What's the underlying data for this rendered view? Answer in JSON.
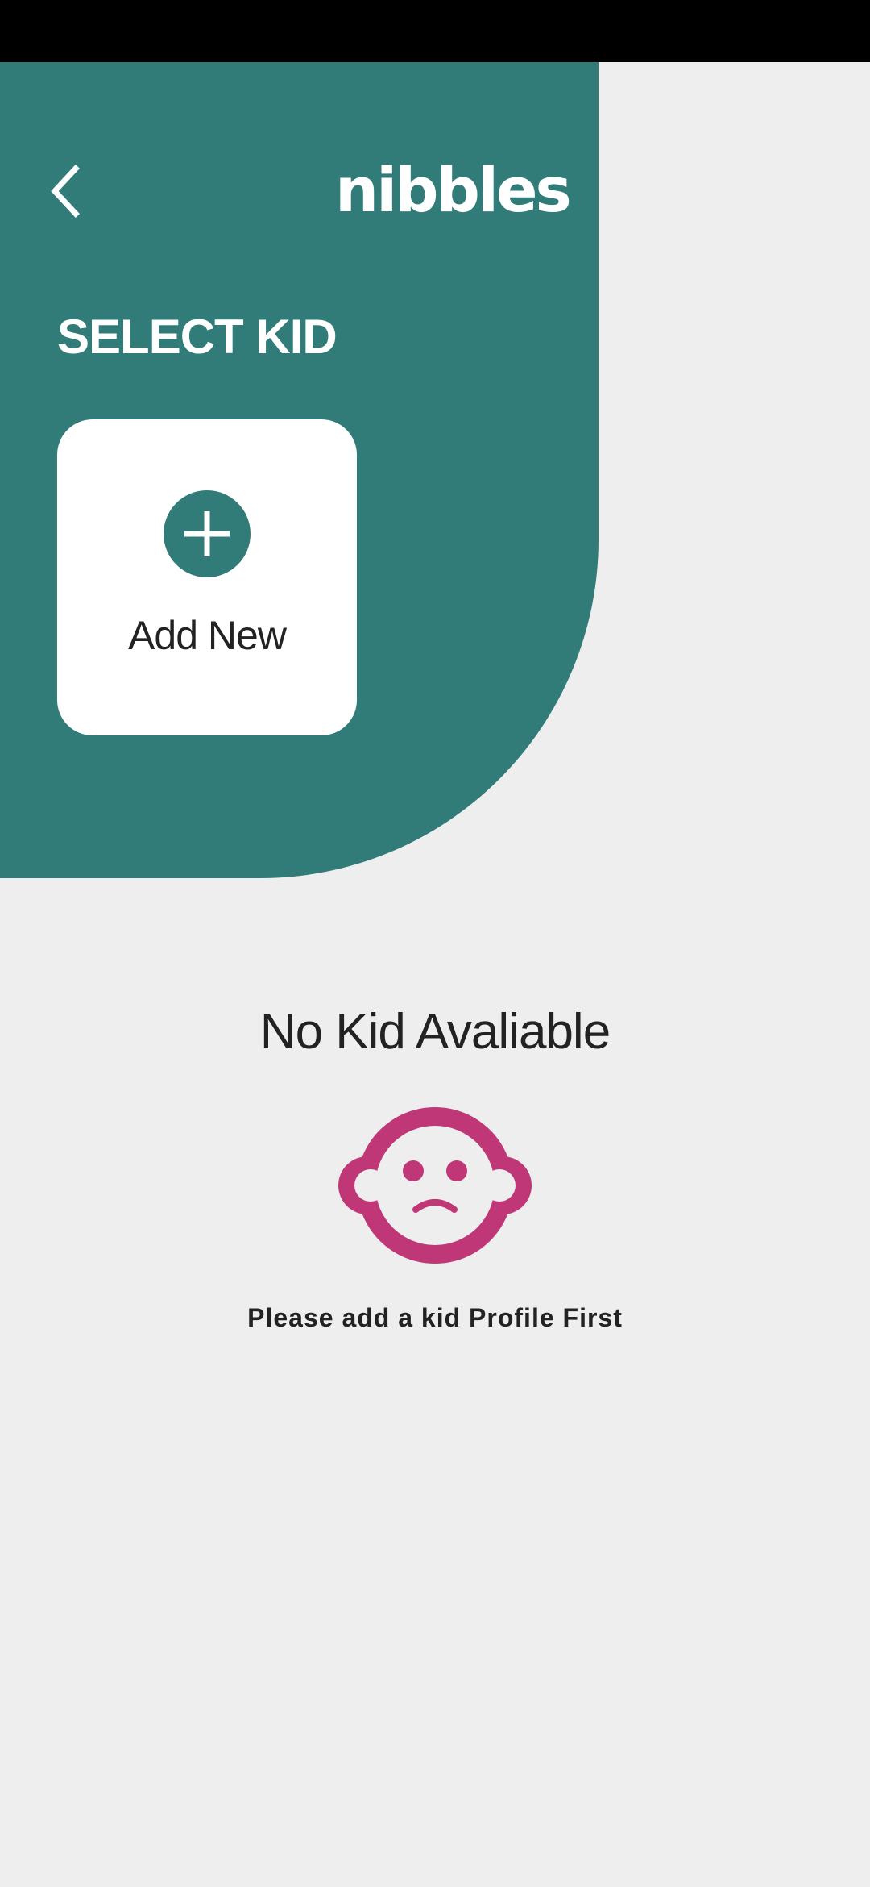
{
  "app": {
    "logo_text": "nibbles"
  },
  "header": {
    "section_title": "SELECT KID"
  },
  "add_card": {
    "label": "Add New"
  },
  "empty_state": {
    "title": "No Kid Avaliable",
    "message": "Please add a kid Profile First",
    "icon": "sad-baby-face-icon"
  },
  "colors": {
    "primary_teal": "#317b79",
    "accent_magenta": "#bf3777",
    "background": "#eeeeee",
    "card_background": "#ffffff",
    "status_bar": "#000000",
    "text_dark": "#222222"
  }
}
